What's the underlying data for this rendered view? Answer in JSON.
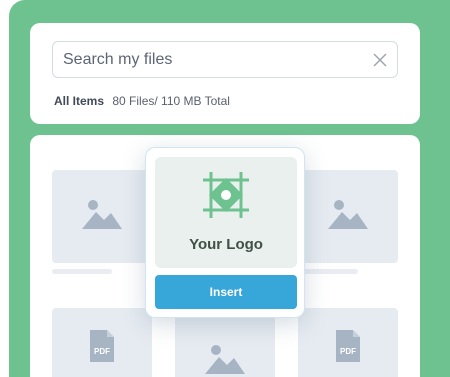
{
  "search": {
    "placeholder": "Search my files"
  },
  "summary": {
    "label": "All Items",
    "stats": "80 Files/ 110 MB Total"
  },
  "popup": {
    "logo_text": "Your Logo",
    "insert_label": "Insert"
  },
  "files": {
    "pdf_label": "PDF"
  },
  "colors": {
    "background_green": "#6dc290",
    "insert_button": "#37a6d8",
    "logo_green": "#6dc290"
  }
}
